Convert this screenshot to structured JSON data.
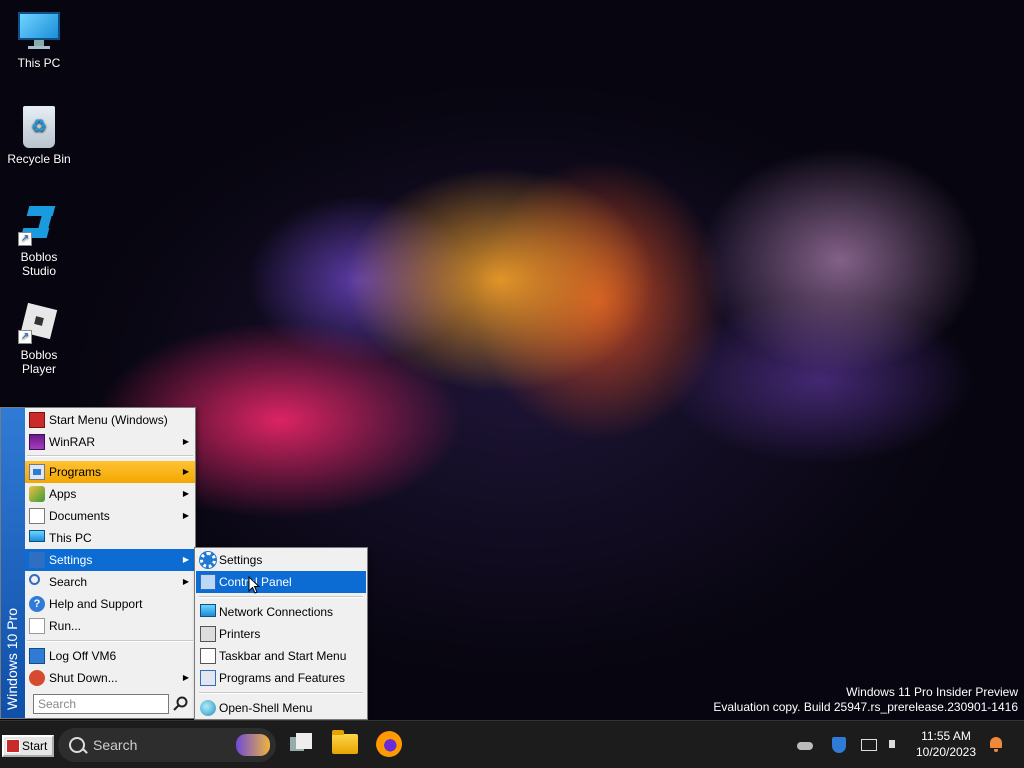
{
  "desktop": {
    "icons": [
      {
        "label": "This PC",
        "icon": "computer-icon"
      },
      {
        "label": "Recycle Bin",
        "icon": "recycle-bin-icon"
      },
      {
        "label": "Boblos Studio",
        "icon": "boblos-studio-icon"
      },
      {
        "label": "Boblos Player",
        "icon": "boblos-player-icon"
      }
    ],
    "watermark": {
      "line1": "Windows 11 Pro Insider Preview",
      "line2": "Evaluation copy. Build 25947.rs_prerelease.230901-1416"
    }
  },
  "start_menu": {
    "banner": "Windows 10 Pro",
    "items": [
      {
        "label": "Start Menu (Windows)",
        "icon": "start-menu-icon",
        "submenu": false
      },
      {
        "label": "WinRAR",
        "icon": "winrar-icon",
        "submenu": true
      },
      {
        "label": "Programs",
        "icon": "programs-icon",
        "submenu": true,
        "state": "hover"
      },
      {
        "label": "Apps",
        "icon": "apps-icon",
        "submenu": true
      },
      {
        "label": "Documents",
        "icon": "documents-icon",
        "submenu": true
      },
      {
        "label": "This PC",
        "icon": "computer-icon",
        "submenu": false
      },
      {
        "label": "Settings",
        "icon": "settings-icon",
        "submenu": true,
        "state": "open"
      },
      {
        "label": "Search",
        "icon": "search-icon",
        "submenu": true
      },
      {
        "label": "Help and Support",
        "icon": "help-icon",
        "submenu": false
      },
      {
        "label": "Run...",
        "icon": "run-icon",
        "submenu": false
      },
      {
        "label": "Log Off VM6",
        "icon": "log-off-icon",
        "submenu": false
      },
      {
        "label": "Shut Down...",
        "icon": "shut-down-icon",
        "submenu": true
      }
    ],
    "search_placeholder": "Search"
  },
  "settings_submenu": {
    "items": [
      {
        "label": "Settings",
        "icon": "gear-icon"
      },
      {
        "label": "Control Panel",
        "icon": "control-panel-icon",
        "state": "selected"
      },
      {
        "label": "Network Connections",
        "icon": "network-icon"
      },
      {
        "label": "Printers",
        "icon": "printer-icon"
      },
      {
        "label": "Taskbar and Start Menu",
        "icon": "taskbar-icon"
      },
      {
        "label": "Programs and Features",
        "icon": "programs-features-icon"
      },
      {
        "label": "Open-Shell Menu",
        "icon": "open-shell-icon"
      }
    ]
  },
  "taskbar": {
    "start_label": "Start",
    "search_label": "Search",
    "apps": [
      "task-view-icon",
      "file-explorer-icon",
      "firefox-icon"
    ],
    "clock": {
      "time": "11:55 AM",
      "date": "10/20/2023"
    }
  },
  "colors": {
    "menu_highlight": "#0c6cd4",
    "programs_highlight": "#f3a700",
    "banner": "#2f7bd6",
    "taskbar": "#1c1c1c"
  }
}
